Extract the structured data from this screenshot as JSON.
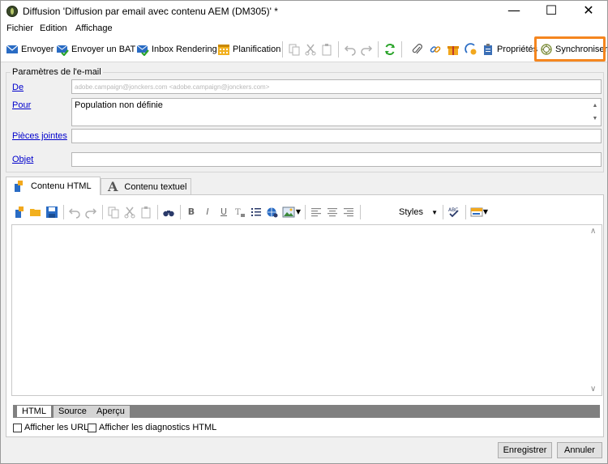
{
  "window": {
    "title": "Diffusion 'Diffusion par email avec contenu AEM (DM305)' *",
    "minimize": "—",
    "maximize": "☐",
    "close": "✕"
  },
  "menu": [
    "Fichier",
    "Edition",
    "Affichage"
  ],
  "toolbar": {
    "send": "Envoyer",
    "send_proof": "Envoyer un BAT",
    "inbox_rendering": "Inbox Rendering",
    "planning": "Planification",
    "properties": "Propriétés",
    "synchronize": "Synchroniser",
    "highlight_color": "#f5861f"
  },
  "email_params": {
    "group_title": "Paramètres de l'e-mail",
    "from_label": "De",
    "from_value": "adobe.campaign@jonckers.com <adobe.campaign@jonckers.com>",
    "to_label": "Pour",
    "to_value": "Population non définie",
    "attachments_label": "Pièces jointes",
    "attachments_value": "",
    "subject_label": "Objet",
    "subject_value": ""
  },
  "tabs": {
    "html": "Contenu HTML",
    "text": "Contenu textuel"
  },
  "editor": {
    "styles_label": "Styles",
    "bold": "B",
    "italic": "I",
    "underline": "U",
    "view_tabs": [
      "HTML",
      "Source",
      "Aperçu"
    ],
    "show_urls": "Afficher les URL",
    "show_diagnostics": "Afficher les diagnostics HTML"
  },
  "buttons": {
    "save": "Enregistrer",
    "cancel": "Annuler"
  }
}
